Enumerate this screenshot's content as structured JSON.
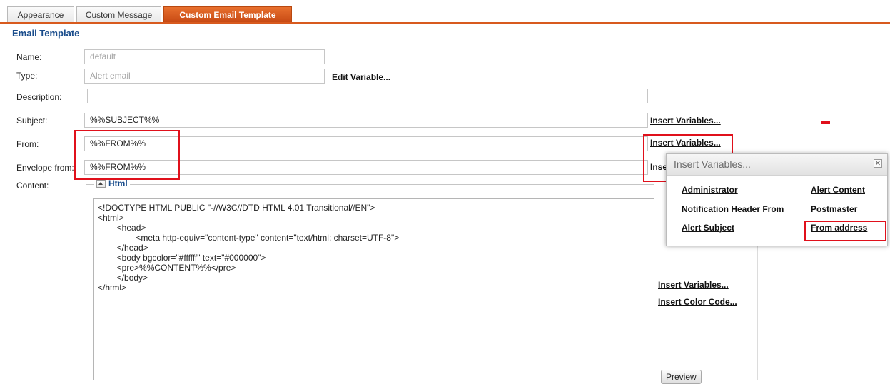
{
  "tabs": [
    {
      "label": "Appearance",
      "active": false
    },
    {
      "label": "Custom Message",
      "active": false
    },
    {
      "label": "Custom Email Template",
      "active": true
    }
  ],
  "fieldset": {
    "legend": "Email Template"
  },
  "form": {
    "name": {
      "label": "Name:",
      "value": "default"
    },
    "type": {
      "label": "Type:",
      "value": "Alert email"
    },
    "edit_variable_link": "Edit Variable...",
    "description": {
      "label": "Description:",
      "value": ""
    },
    "subject": {
      "label": "Subject:",
      "value": "%%SUBJECT%%"
    },
    "from": {
      "label": "From:",
      "value": "%%FROM%%"
    },
    "envelope_from": {
      "label": "Envelope from:",
      "value": "%%FROM%%"
    },
    "content": {
      "label": "Content:"
    },
    "insert_variables_link": "Insert Variables...",
    "envelope_insert_link_partial": "Inse"
  },
  "html_section": {
    "legend": "Html",
    "code_lines": [
      "<!DOCTYPE HTML PUBLIC \"-//W3C//DTD HTML 4.01 Transitional//EN\">",
      "<html>",
      "        <head>",
      "                <meta http-equiv=\"content-type\" content=\"text/html; charset=UTF-8\">",
      "        </head>",
      "        <body bgcolor=\"#ffffff\" text=\"#000000\">",
      "        <pre>%%CONTENT%%</pre>",
      "        </body>",
      "</html>"
    ],
    "insert_variables_link": "Insert Variables...",
    "insert_color_code_link": "Insert Color Code...",
    "preview_button": "Preview"
  },
  "popup": {
    "title": "Insert Variables...",
    "close_glyph": "✕",
    "items": [
      "Administrator",
      "Alert Content",
      "Notification Header From",
      "Postmaster",
      "Alert Subject",
      "From address"
    ]
  },
  "colors": {
    "active_tab": "#d85a1e",
    "legend_text": "#1a4d8c",
    "highlight_red": "#e0101b"
  }
}
